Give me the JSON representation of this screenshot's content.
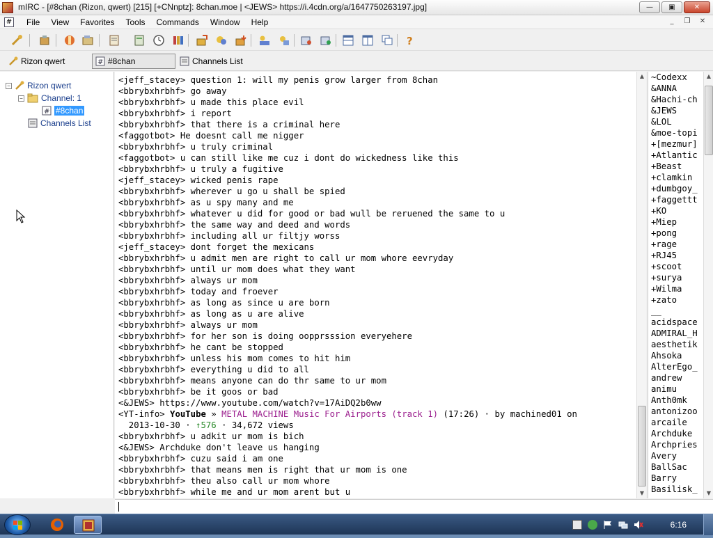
{
  "window": {
    "title": "mIRC - [#8chan (Rizon, qwert) [215] [+CNnptz]: 8chan.moe | <JEWS> https://i.4cdn.org/a/1647750263197.jpg]",
    "btn_min": "—",
    "btn_max": "▣",
    "btn_close": "✕"
  },
  "menu": {
    "items": [
      "File",
      "View",
      "Favorites",
      "Tools",
      "Commands",
      "Window",
      "Help"
    ],
    "mdi_icon": "#",
    "mdi_min": "_",
    "mdi_restore": "❐",
    "mdi_close": "✕"
  },
  "switchbar": {
    "server": "Rizon qwert",
    "channel": "#8chan",
    "channels_list": "Channels List"
  },
  "tree": {
    "server": "Rizon qwert",
    "folder": "Channel: 1",
    "channel": "#8chan",
    "channels_list": "Channels List",
    "exp_minus": "−"
  },
  "chat": {
    "lines": [
      "<jeff_stacey> question 1: will my penis grow larger from 8chan",
      "<bbrybxhrbhf> go away",
      "<bbrybxhrbhf> u made this place evil",
      "<bbrybxhrbhf> i report",
      "<bbrybxhrbhf> that there is a criminal here",
      "<faggotbot> He doesnt call me nigger",
      "<bbrybxhrbhf> u truly criminal",
      "<faggotbot> u can still like me cuz i dont do wickedness like this",
      "<bbrybxhrbhf> u truly a fugitive",
      "<jeff_stacey> wicked penis rape",
      "<bbrybxhrbhf> wherever u go u shall be spied",
      "<bbrybxhrbhf> as u spy many and me",
      "<bbrybxhrbhf> whatever u did for good or bad wull be reruened the same to u",
      "<bbrybxhrbhf> the same way and deed and words",
      "<bbrybxhrbhf> including all ur filtjy worss",
      "<jeff_stacey> dont forget the mexicans",
      "<bbrybxhrbhf> u admit men are right to call ur mom whore eevryday",
      "<bbrybxhrbhf> until ur mom does what they want",
      "<bbrybxhrbhf> always ur mom",
      "<bbrybxhrbhf> today and froever",
      "<bbrybxhrbhf> as long as since u are born",
      "<bbrybxhrbhf> as long as u are alive",
      "<bbrybxhrbhf> always ur mom",
      "<bbrybxhrbhf> for her son is doing oopprsssion everyehere",
      "<bbrybxhrbhf> he cant be stopped",
      "<bbrybxhrbhf> unless his mom comes to hit him",
      "<bbrybxhrbhf> everything u did to all",
      "<bbrybxhrbhf> means anyone can do thr same to ur mom",
      "<bbrybxhrbhf> be it goos or bad",
      "<&JEWS> https://www.youtube.com/watch?v=17AiDQ2b0ww"
    ],
    "yt": {
      "prefix": "<YT-info> ",
      "brand": "YouTube",
      "sep": " » ",
      "title": "METAL MACHINE Music For Airports (track 1)",
      "rest1": " (17:26) · by machined01 on",
      "cont_indent": "  2013-10-30 · ",
      "likes": "↑576",
      "views": " · 34,672 views"
    },
    "lines_after": [
      "<bbrybxhrbhf> u adkit ur mom is bich",
      "<&JEWS> Archduke don't leave us hanging",
      "<bbrybxhrbhf> cuzu said i am one",
      "<bbrybxhrbhf> that means men is right that ur mom is one",
      "<bbrybxhrbhf> theu also call ur mom whore",
      "<bbrybxhrbhf> while me and ur mom arent but u"
    ],
    "scroll_up": "▲",
    "scroll_down": "▼"
  },
  "nicklist": {
    "nicks": [
      "~Codexx",
      "&ANNA",
      "&Hachi-ch",
      "&JEWS",
      "&LOL",
      "&moe-topi",
      "+[mezmur]",
      "+Atlantic",
      "+Beast",
      "+clamkin",
      "+dumbgoy_",
      "+faggettt",
      "+KO",
      "+Miep",
      "+pong",
      "+rage",
      "+RJ45",
      "+scoot",
      "+surya",
      "+Wilma",
      "+zato",
      "__",
      "acidspace",
      "ADMIRAL_H",
      "aesthetik",
      "Ahsoka",
      "AlterEgo_",
      "andrew",
      "animu",
      "Anth0mk",
      "antonizoo",
      "arcaile",
      "Archduke",
      "Archpries",
      "Avery",
      "BallSac",
      "Barry",
      "Basilisk_"
    ]
  },
  "taskbar": {
    "clock": "6:16"
  },
  "colors": {
    "selection": "#3399ff",
    "tree_text": "#1a3e8c",
    "yt_title": "#9b1f8e",
    "yt_green": "#2a8a2a",
    "taskbar": "#1e3556"
  }
}
